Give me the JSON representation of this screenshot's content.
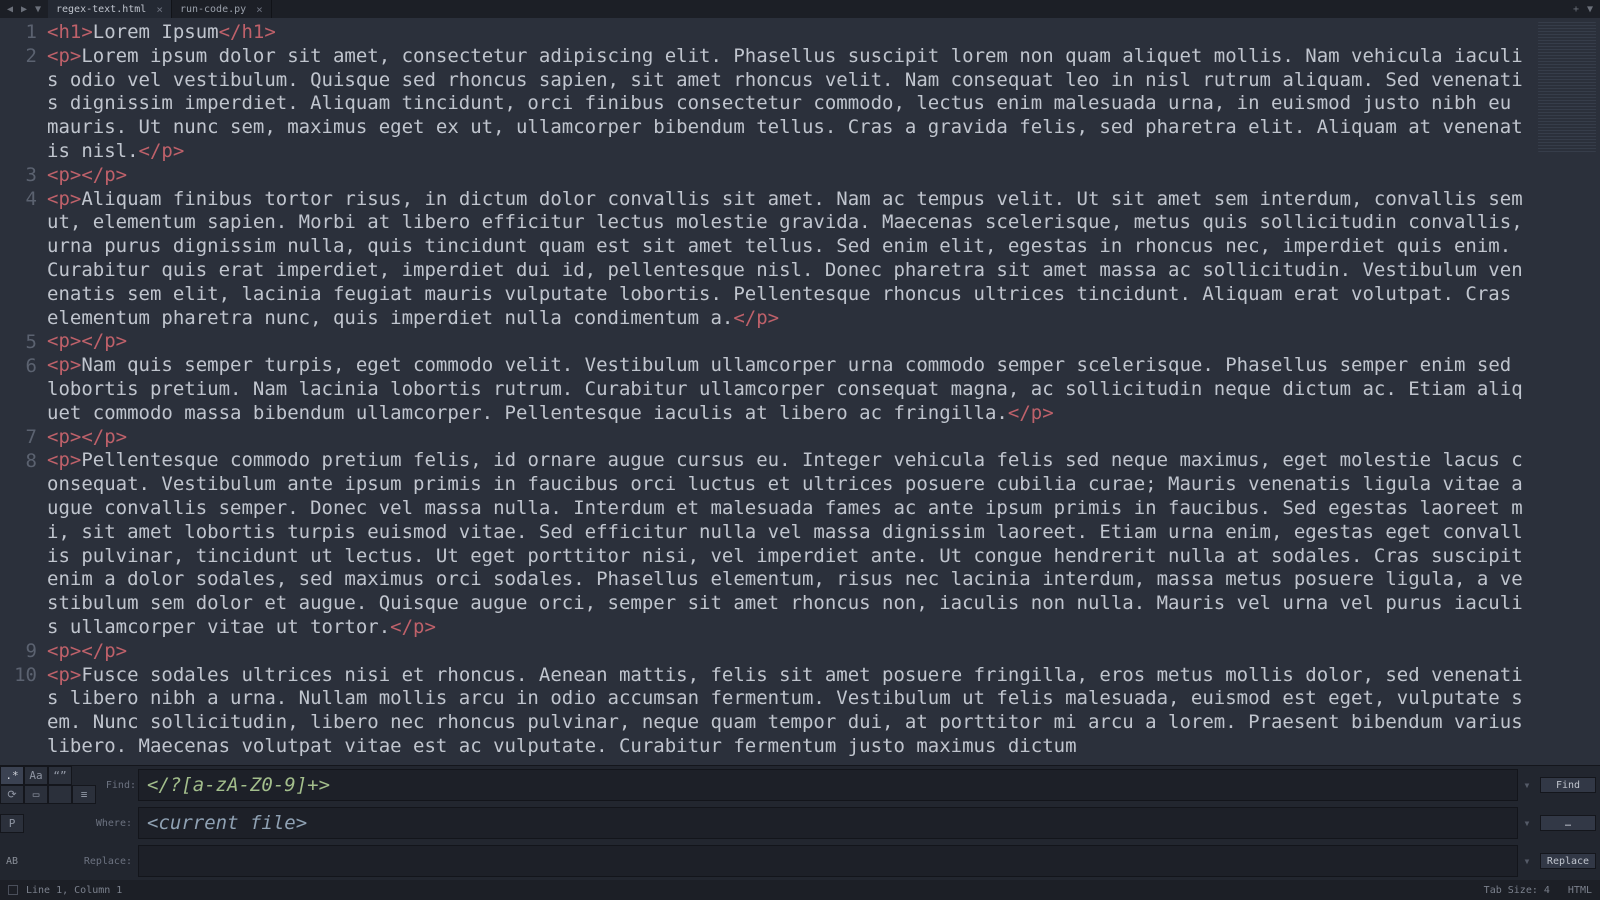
{
  "nav_icons": {
    "left": "◀",
    "right": "▶",
    "down": "▼"
  },
  "tabs": [
    {
      "label": "regex-text.html",
      "active": true
    },
    {
      "label": "run-code.py",
      "active": false
    }
  ],
  "title_right": {
    "a": "+",
    "b": "▼"
  },
  "code": {
    "lines": [
      {
        "n": "1",
        "segs": [
          [
            "tag",
            "<h1>"
          ],
          [
            "txt",
            "Lorem Ipsum"
          ],
          [
            "tag",
            "</h1>"
          ]
        ]
      },
      {
        "n": "2",
        "segs": [
          [
            "tag",
            "<p>"
          ],
          [
            "txt",
            "Lorem ipsum dolor sit amet, consectetur adipiscing elit. Phasellus suscipit lorem non quam aliquet mollis. Nam vehicula iaculis odio vel vestibulum. Quisque sed rhoncus sapien, sit amet rhoncus velit. Nam consequat leo in nisl rutrum aliquam. Sed venenatis dignissim imperdiet. Aliquam tincidunt, orci finibus consectetur commodo, lectus enim malesuada urna, in euismod justo nibh eu mauris. Ut nunc sem, maximus eget ex ut, ullamcorper bibendum tellus. Cras a gravida felis, sed pharetra elit. Aliquam at venenatis nisl."
          ],
          [
            "tag",
            "</p>"
          ]
        ]
      },
      {
        "n": "3",
        "segs": [
          [
            "tag",
            "<p>"
          ],
          [
            "tag",
            "</p>"
          ]
        ]
      },
      {
        "n": "4",
        "segs": [
          [
            "tag",
            "<p>"
          ],
          [
            "txt",
            "Aliquam finibus tortor risus, in dictum dolor convallis sit amet. Nam ac tempus velit. Ut sit amet sem interdum, convallis sem ut, elementum sapien. Morbi at libero efficitur lectus molestie gravida. Maecenas scelerisque, metus quis sollicitudin convallis, urna purus dignissim nulla, quis tincidunt quam est sit amet tellus. Sed enim elit, egestas in rhoncus nec, imperdiet quis enim. Curabitur quis erat imperdiet, imperdiet dui id, pellentesque nisl. Donec pharetra sit amet massa ac sollicitudin. Vestibulum venenatis sem elit, lacinia feugiat mauris vulputate lobortis. Pellentesque rhoncus ultrices tincidunt. Aliquam erat volutpat. Cras elementum pharetra nunc, quis imperdiet nulla condimentum a."
          ],
          [
            "tag",
            "</p>"
          ]
        ]
      },
      {
        "n": "5",
        "segs": [
          [
            "tag",
            "<p>"
          ],
          [
            "tag",
            "</p>"
          ]
        ]
      },
      {
        "n": "6",
        "segs": [
          [
            "tag",
            "<p>"
          ],
          [
            "txt",
            "Nam quis semper turpis, eget commodo velit. Vestibulum ullamcorper urna commodo semper scelerisque. Phasellus semper enim sed lobortis pretium. Nam lacinia lobortis rutrum. Curabitur ullamcorper consequat magna, ac sollicitudin neque dictum ac. Etiam aliquet commodo massa bibendum ullamcorper. Pellentesque iaculis at libero ac fringilla."
          ],
          [
            "tag",
            "</p>"
          ]
        ]
      },
      {
        "n": "7",
        "segs": [
          [
            "tag",
            "<p>"
          ],
          [
            "tag",
            "</p>"
          ]
        ]
      },
      {
        "n": "8",
        "segs": [
          [
            "tag",
            "<p>"
          ],
          [
            "txt",
            "Pellentesque commodo pretium felis, id ornare augue cursus eu. Integer vehicula felis sed neque maximus, eget molestie lacus consequat. Vestibulum ante ipsum primis in faucibus orci luctus et ultrices posuere cubilia curae; Mauris venenatis ligula vitae augue convallis semper. Donec vel massa nulla. Interdum et malesuada fames ac ante ipsum primis in faucibus. Sed egestas laoreet mi, sit amet lobortis turpis euismod vitae. Sed efficitur nulla vel massa dignissim laoreet. Etiam urna enim, egestas eget convallis pulvinar, tincidunt ut lectus. Ut eget porttitor nisi, vel imperdiet ante. Ut congue hendrerit nulla at sodales. Cras suscipit enim a dolor sodales, sed maximus orci sodales. Phasellus elementum, risus nec lacinia interdum, massa metus posuere ligula, a vestibulum sem dolor et augue. Quisque augue orci, semper sit amet rhoncus non, iaculis non nulla. Mauris vel urna vel purus iaculis ullamcorper vitae ut tortor."
          ],
          [
            "tag",
            "</p>"
          ]
        ]
      },
      {
        "n": "9",
        "segs": [
          [
            "tag",
            "<p>"
          ],
          [
            "tag",
            "</p>"
          ]
        ]
      },
      {
        "n": "10",
        "segs": [
          [
            "tag",
            "<p>"
          ],
          [
            "txt",
            "Fusce sodales ultrices nisi et rhoncus. Aenean mattis, felis sit amet posuere fringilla, eros metus mollis dolor, sed venenatis libero nibh a urna. Nullam mollis arcu in odio accumsan fermentum. Vestibulum ut felis malesuada, euismod est eget, vulputate sem. Nunc sollicitudin, libero nec rhoncus pulvinar, neque quam tempor dui, at porttitor mi arcu a lorem. Praesent bibendum varius libero. Maecenas volutpat vitae est ac vulputate. Curabitur fermentum justo maximus dictum"
          ]
        ]
      }
    ]
  },
  "find": {
    "toggles": {
      "regex": ".*",
      "case": "Aa",
      "word": "“”",
      "wrap": "⟳",
      "sel": "▭",
      "hl": "",
      "ctx": "≡"
    },
    "preserve": "P",
    "labels": {
      "find": "Find:",
      "where": "Where:",
      "replace": "Replace:"
    },
    "find_value": "</?[a-zA-Z0-9]+>",
    "where_value": "<current file>",
    "replace_value": "",
    "buttons": {
      "find": "Find",
      "where": "…",
      "replace": "Replace"
    },
    "ab": "AB"
  },
  "status": {
    "pos": "Line 1, Column 1",
    "tab": "Tab Size: 4",
    "lang": "HTML"
  }
}
